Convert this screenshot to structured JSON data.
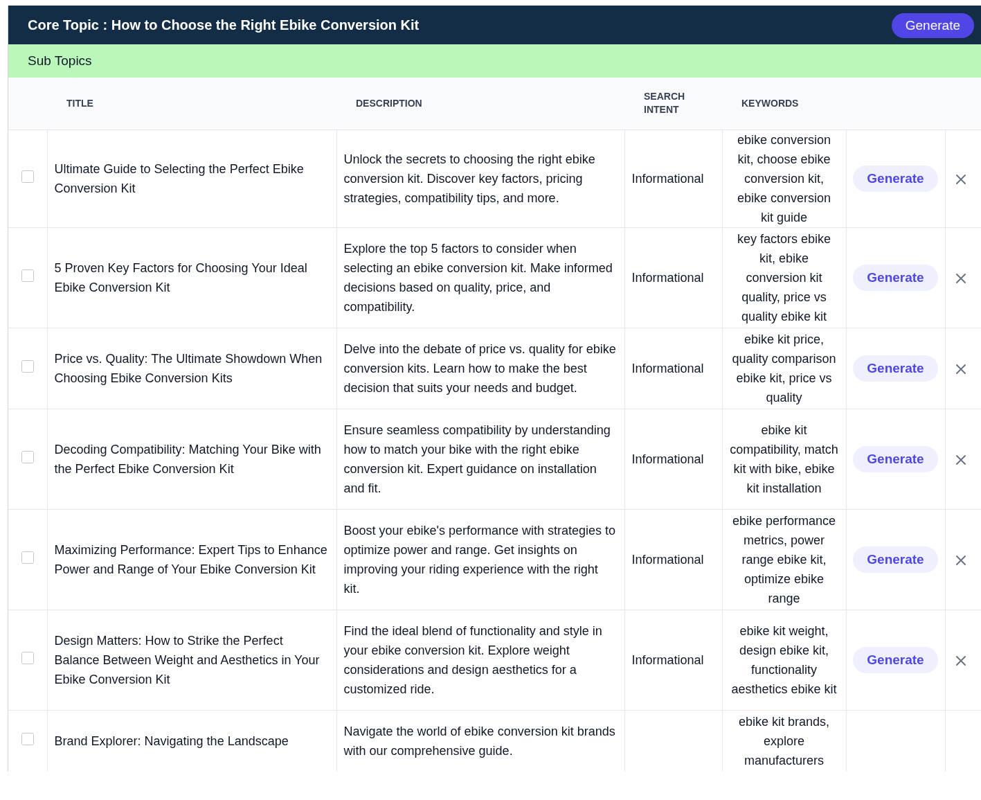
{
  "header": {
    "title": "Core Topic : How to Choose the Right Ebike Conversion Kit",
    "button": "Generate"
  },
  "section": {
    "title": "Sub Topics"
  },
  "table": {
    "columns": [
      "TITLE",
      "DESCRIPTION",
      "SEARCH INTENT",
      "KEYWORDS"
    ],
    "rows": [
      {
        "checked": false,
        "title": "Ultimate Guide to Selecting the Perfect Ebike Conversion Kit",
        "description": "Unlock the secrets to choosing the right ebike conversion kit. Discover key factors, pricing strategies, compatibility tips, and more.",
        "intent": "Informational",
        "keywords": "ebike conversion kit, choose ebike conversion kit, ebike conversion kit guide",
        "button": "Generate"
      },
      {
        "checked": false,
        "title": "5 Proven Key Factors for Choosing Your Ideal Ebike Conversion Kit",
        "description": "Explore the top 5 factors to consider when selecting an ebike conversion kit. Make informed decisions based on quality, price, and compatibility.",
        "intent": "Informational",
        "keywords": "key factors ebike kit, ebike conversion kit quality, price vs quality ebike kit",
        "button": "Generate"
      },
      {
        "checked": false,
        "title": "Price vs. Quality: The Ultimate Showdown When Choosing Ebike Conversion Kits",
        "description": "Delve into the debate of price vs. quality for ebike conversion kits. Learn how to make the best decision that suits your needs and budget.",
        "intent": "Informational",
        "keywords": "ebike kit price, quality comparison ebike kit, price vs quality",
        "button": "Generate"
      },
      {
        "checked": false,
        "title": "Decoding Compatibility: Matching Your Bike with the Perfect Ebike Conversion Kit",
        "description": "Ensure seamless compatibility by understanding how to match your bike with the right ebike conversion kit. Expert guidance on installation and fit.",
        "intent": "Informational",
        "keywords": "ebike kit compatibility, match kit with bike, ebike kit installation",
        "button": "Generate"
      },
      {
        "checked": false,
        "title": "Maximizing Performance: Expert Tips to Enhance Power and Range of Your Ebike Conversion Kit",
        "description": "Boost your ebike's performance with strategies to optimize power and range. Get insights on improving your riding experience with the right kit.",
        "intent": "Informational",
        "keywords": "ebike performance metrics, power range ebike kit, optimize ebike range",
        "button": "Generate"
      },
      {
        "checked": false,
        "title": "Design Matters: How to Strike the Perfect Balance Between Weight and Aesthetics in Your Ebike Conversion Kit",
        "description": "Find the ideal blend of functionality and style in your ebike conversion kit. Explore weight considerations and design aesthetics for a customized ride.",
        "intent": "Informational",
        "keywords": "ebike kit weight, design ebike kit, functionality aesthetics ebike kit",
        "button": "Generate"
      },
      {
        "checked": false,
        "title": "Brand Explorer: Navigating the Landscape",
        "description": "Navigate the world of ebike conversion kit brands with our comprehensive guide.",
        "keywords": "ebike kit brands, explore manufacturers"
      }
    ]
  }
}
